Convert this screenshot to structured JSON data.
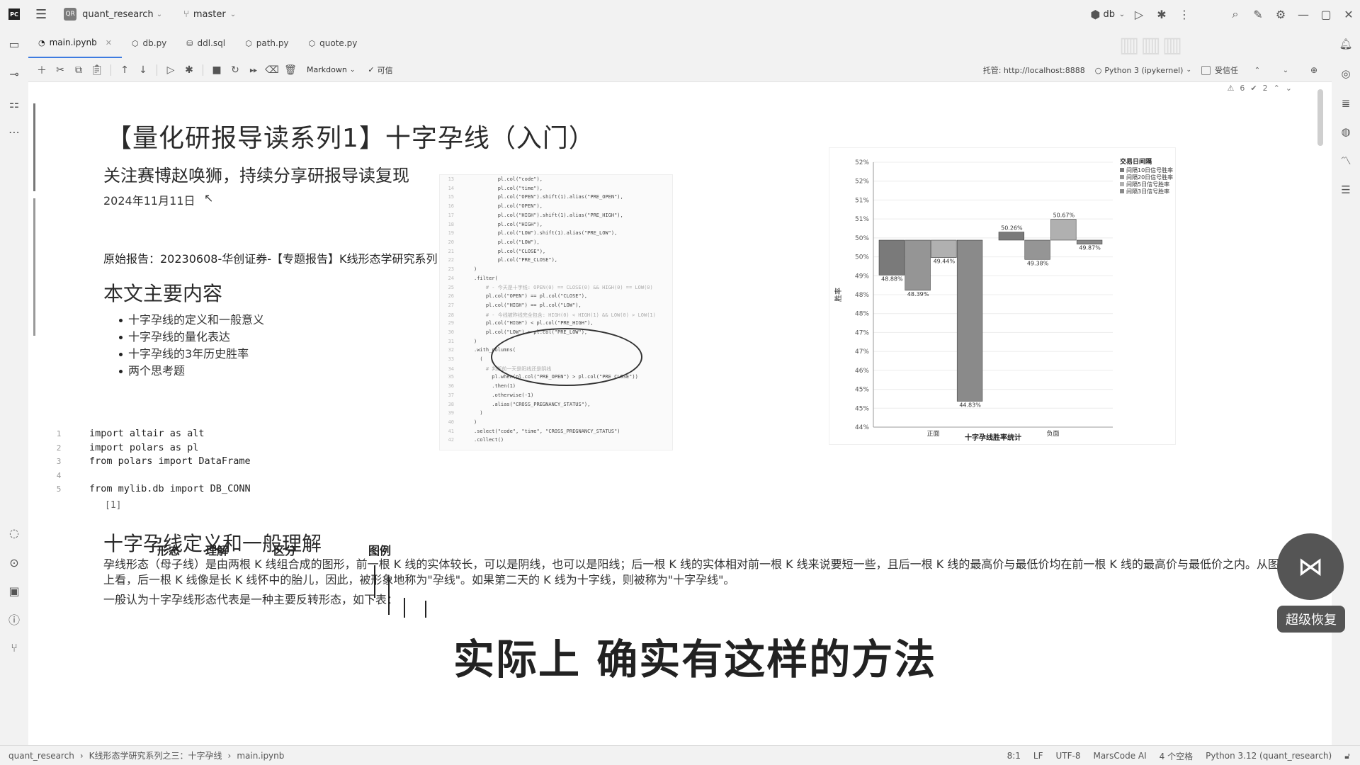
{
  "titlebar": {
    "project": "quant_research",
    "branch": "master",
    "run_config": "db"
  },
  "tabs": [
    {
      "label": "main.ipynb",
      "active": true
    },
    {
      "label": "db.py"
    },
    {
      "label": "ddl.sql"
    },
    {
      "label": "path.py"
    },
    {
      "label": "quote.py"
    }
  ],
  "toolbar": {
    "cell_type": "Markdown",
    "trusted_label": "可信",
    "server_label": "托管: http://localhost:8888",
    "kernel": "Python 3 (ipykernel)",
    "trust_toggle": "受信任",
    "warnings": "6",
    "errors": "2"
  },
  "notebook": {
    "title": "【量化研报导读系列1】十字孕线（入门）",
    "subtitle": "关注赛博赵唤狮，持续分享研报导读复现",
    "date": "2024年11月11日",
    "source": "原始报告：20230608-华创证券-【专题报告】K线形态学研究系列",
    "contents_heading": "本文主要内容",
    "contents": [
      "十字孕线的定义和一般意义",
      "十字孕线的量化表达",
      "十字孕线的3年历史胜率",
      "两个思考题"
    ],
    "code_lines": [
      {
        "n": "1",
        "text": "import altair as alt"
      },
      {
        "n": "2",
        "text": "import polars as pl"
      },
      {
        "n": "3",
        "text": "from polars import DataFrame"
      },
      {
        "n": "4",
        "text": ""
      },
      {
        "n": "5",
        "text": "from mylib.db import DB_CONN"
      }
    ],
    "exec_count": "[1]",
    "section_heading": "十字孕线定义和一般理解",
    "paragraph": "孕线形态（母子线）是由两根 K 线组合成的图形，前一根 K 线的实体较长，可以是阴线，也可以是阳线；后一根 K 线的实体相对前一根 K 线来说要短一些，且后一根 K 线的最高价与最低价均在前一根 K 线的最高价与最低价之内。从图形上看，后一根 K 线像是长 K 线怀中的胎儿，因此，被形象地称为\"孕线\"。如果第二天的 K 线为十字线，则被称为\"十字孕线\"。",
    "paragraph2": "一般认为十字孕线形态代表是一种主要反转形态，如下表：",
    "table_headers": [
      "形态",
      "理解",
      "区分",
      "图例"
    ]
  },
  "code_image": {
    "lines": [
      {
        "n": "13",
        "t": "pl.col(\"code\"),"
      },
      {
        "n": "14",
        "t": "pl.col(\"time\"),"
      },
      {
        "n": "15",
        "t": "pl.col(\"OPEN\").shift(1).alias(\"PRE_OPEN\"),"
      },
      {
        "n": "16",
        "t": "pl.col(\"OPEN\"),"
      },
      {
        "n": "17",
        "t": "pl.col(\"HIGH\").shift(1).alias(\"PRE_HIGH\"),"
      },
      {
        "n": "18",
        "t": "pl.col(\"HIGH\"),"
      },
      {
        "n": "19",
        "t": "pl.col(\"LOW\").shift(1).alias(\"PRE_LOW\"),"
      },
      {
        "n": "20",
        "t": "pl.col(\"LOW\"),"
      },
      {
        "n": "21",
        "t": "pl.col(\"CLOSE\"),"
      },
      {
        "n": "22",
        "t": "pl.col(\"PRE_CLOSE\"),"
      },
      {
        "n": "23",
        "t": ")"
      },
      {
        "n": "24",
        "t": ".filter("
      },
      {
        "n": "25",
        "t": "# - 今天是十字线: OPEN(0) == CLOSE(0) && HIGH(0) == LOW(0)"
      },
      {
        "n": "26",
        "t": "pl.col(\"OPEN\") == pl.col(\"CLOSE\"),"
      },
      {
        "n": "27",
        "t": "pl.col(\"HIGH\") == pl.col(\"LOW\"),"
      },
      {
        "n": "28",
        "t": "# - 今线被昨线完全包含: HIGH(0) < HIGH(1) && LOW(0) > LOW(1)"
      },
      {
        "n": "29",
        "t": "pl.col(\"HIGH\") < pl.col(\"PRE_HIGH\"),"
      },
      {
        "n": "30",
        "t": "pl.col(\"LOW\") > pl.col(\"PRE_LOW\"),"
      },
      {
        "n": "31",
        "t": ")"
      },
      {
        "n": "32",
        "t": ".with_columns("
      },
      {
        "n": "33",
        "t": "("
      },
      {
        "n": "34",
        "t": "# 判断前一天是阳线还是阴线"
      },
      {
        "n": "35",
        "t": "pl.when(pl.col(\"PRE_OPEN\") > pl.col(\"PRE_CLOSE\"))"
      },
      {
        "n": "36",
        "t": ".then(1)"
      },
      {
        "n": "37",
        "t": ".otherwise(-1)"
      },
      {
        "n": "38",
        "t": ".alias(\"CROSS_PREGNANCY_STATUS\"),"
      },
      {
        "n": "39",
        "t": ")"
      },
      {
        "n": "40",
        "t": ")"
      },
      {
        "n": "41",
        "t": ".select(\"code\", \"time\", \"CROSS_PREGNANCY_STATUS\")"
      },
      {
        "n": "42",
        "t": ".collect()"
      }
    ]
  },
  "chart_data": {
    "type": "bar",
    "xlabel": "十字孕线胜率统计",
    "ylabel": "胜率",
    "categories": [
      "正面",
      "负面"
    ],
    "yticks": [
      "44%",
      "45%",
      "45%",
      "46%",
      "47%",
      "47%",
      "48%",
      "48%",
      "49%",
      "50%",
      "50%",
      "51%",
      "51%",
      "52%",
      "52%"
    ],
    "ylim": [
      44,
      52.5
    ],
    "baseline": 50,
    "series": [
      {
        "name": "间隔10日信号胜率",
        "values": [
          48.88,
          50.26
        ]
      },
      {
        "name": "间隔20日信号胜率",
        "values": [
          48.39,
          49.38
        ]
      },
      {
        "name": "间隔5日信号胜率",
        "values": [
          49.44,
          50.67
        ]
      },
      {
        "name": "间隔3日信号胜率",
        "values": [
          44.83,
          49.87
        ]
      }
    ],
    "data_labels": [
      "48.88%",
      "48.39%",
      "49.44%",
      "44.83%",
      "50.26%",
      "49.38%",
      "50.67%",
      "49.87%"
    ],
    "legend_title": "交易日间隔",
    "legend_placement": "top-right"
  },
  "overlay_caption": "实际上 确实有这样的方法",
  "restore": {
    "label": "超级恢复"
  },
  "statusbar": {
    "crumbs": [
      "quant_research",
      "K线形态学研究系列之三：十字孕线",
      "main.ipynb"
    ],
    "position": "8:1",
    "line_sep": "LF",
    "encoding": "UTF-8",
    "ai": "MarsCode AI",
    "indent": "4 个空格",
    "interpreter": "Python 3.12 (quant_research)"
  },
  "colors": {
    "accent": "#3d7be0",
    "bar_dark": "#7a7a7a",
    "bar_light": "#a0a0a0"
  }
}
